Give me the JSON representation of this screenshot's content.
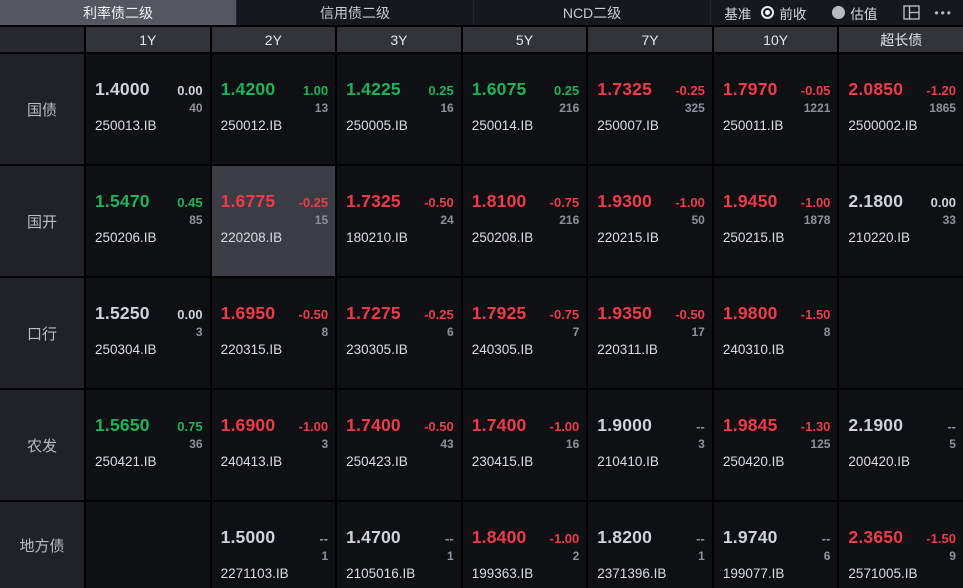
{
  "topbar": {
    "tabs": [
      {
        "label": "利率债二级",
        "active": true
      },
      {
        "label": "信用债二级",
        "active": false
      },
      {
        "label": "NCD二级",
        "active": false
      }
    ],
    "benchmark_label": "基准",
    "radios": [
      {
        "label": "前收",
        "selected": true
      },
      {
        "label": "估值",
        "selected": false
      }
    ],
    "more_glyph": "•••",
    "icons": [
      "layout-icon",
      "more-icon"
    ]
  },
  "columns": [
    "1Y",
    "2Y",
    "3Y",
    "5Y",
    "7Y",
    "10Y",
    "超长债"
  ],
  "rows": [
    {
      "label": "国债",
      "cells": [
        {
          "value": "1.4000",
          "change": "0.00",
          "count": "40",
          "code": "250013.IB",
          "trend": "flat"
        },
        {
          "value": "1.4200",
          "change": "1.00",
          "count": "13",
          "code": "250012.IB",
          "trend": "up"
        },
        {
          "value": "1.4225",
          "change": "0.25",
          "count": "16",
          "code": "250005.IB",
          "trend": "up"
        },
        {
          "value": "1.6075",
          "change": "0.25",
          "count": "216",
          "code": "250014.IB",
          "trend": "up"
        },
        {
          "value": "1.7325",
          "change": "-0.25",
          "count": "325",
          "code": "250007.IB",
          "trend": "down"
        },
        {
          "value": "1.7970",
          "change": "-0.05",
          "count": "1221",
          "code": "250011.IB",
          "trend": "down"
        },
        {
          "value": "2.0850",
          "change": "-1.20",
          "count": "1865",
          "code": "2500002.IB",
          "trend": "down"
        }
      ]
    },
    {
      "label": "国开",
      "cells": [
        {
          "value": "1.5470",
          "change": "0.45",
          "count": "85",
          "code": "250206.IB",
          "trend": "up"
        },
        {
          "value": "1.6775",
          "change": "-0.25",
          "count": "15",
          "code": "220208.IB",
          "trend": "down",
          "highlighted": true
        },
        {
          "value": "1.7325",
          "change": "-0.50",
          "count": "24",
          "code": "180210.IB",
          "trend": "down"
        },
        {
          "value": "1.8100",
          "change": "-0.75",
          "count": "216",
          "code": "250208.IB",
          "trend": "down"
        },
        {
          "value": "1.9300",
          "change": "-1.00",
          "count": "50",
          "code": "220215.IB",
          "trend": "down"
        },
        {
          "value": "1.9450",
          "change": "-1.00",
          "count": "1878",
          "code": "250215.IB",
          "trend": "down"
        },
        {
          "value": "2.1800",
          "change": "0.00",
          "count": "33",
          "code": "210220.IB",
          "trend": "flat"
        }
      ]
    },
    {
      "label": "口行",
      "cells": [
        {
          "value": "1.5250",
          "change": "0.00",
          "count": "3",
          "code": "250304.IB",
          "trend": "flat"
        },
        {
          "value": "1.6950",
          "change": "-0.50",
          "count": "8",
          "code": "220315.IB",
          "trend": "down"
        },
        {
          "value": "1.7275",
          "change": "-0.25",
          "count": "6",
          "code": "230305.IB",
          "trend": "down"
        },
        {
          "value": "1.7925",
          "change": "-0.75",
          "count": "7",
          "code": "240305.IB",
          "trend": "down"
        },
        {
          "value": "1.9350",
          "change": "-0.50",
          "count": "17",
          "code": "220311.IB",
          "trend": "down"
        },
        {
          "value": "1.9800",
          "change": "-1.50",
          "count": "8",
          "code": "240310.IB",
          "trend": "down"
        },
        null
      ]
    },
    {
      "label": "农发",
      "cells": [
        {
          "value": "1.5650",
          "change": "0.75",
          "count": "36",
          "code": "250421.IB",
          "trend": "up"
        },
        {
          "value": "1.6900",
          "change": "-1.00",
          "count": "3",
          "code": "240413.IB",
          "trend": "down"
        },
        {
          "value": "1.7400",
          "change": "-0.50",
          "count": "43",
          "code": "250423.IB",
          "trend": "down"
        },
        {
          "value": "1.7400",
          "change": "-1.00",
          "count": "16",
          "code": "230415.IB",
          "trend": "down"
        },
        {
          "value": "1.9000",
          "change": "--",
          "count": "3",
          "code": "210410.IB",
          "trend": "flat"
        },
        {
          "value": "1.9845",
          "change": "-1.30",
          "count": "125",
          "code": "250420.IB",
          "trend": "down"
        },
        {
          "value": "2.1900",
          "change": "--",
          "count": "5",
          "code": "200420.IB",
          "trend": "flat"
        }
      ]
    },
    {
      "label": "地方债",
      "cells": [
        null,
        {
          "value": "1.5000",
          "change": "--",
          "count": "1",
          "code": "2271103.IB",
          "trend": "flat"
        },
        {
          "value": "1.4700",
          "change": "--",
          "count": "1",
          "code": "2105016.IB",
          "trend": "flat"
        },
        {
          "value": "1.8400",
          "change": "-1.00",
          "count": "2",
          "code": "199363.IB",
          "trend": "down"
        },
        {
          "value": "1.8200",
          "change": "--",
          "count": "1",
          "code": "2371396.IB",
          "trend": "flat"
        },
        {
          "value": "1.9740",
          "change": "--",
          "count": "6",
          "code": "199077.IB",
          "trend": "flat"
        },
        {
          "value": "2.3650",
          "change": "-1.50",
          "count": "9",
          "code": "2571005.IB",
          "trend": "down"
        }
      ]
    }
  ],
  "colors": {
    "up_green": "#1cb35b",
    "down_red": "#ee3b49",
    "flat_white": "#ced2d9",
    "count_gray": "#8d929b",
    "active_tab_bg": "#55575f",
    "header_bg": "#323439",
    "cell_bg": "#0f1014",
    "highlight_cell_bg": "#3b3d44"
  }
}
